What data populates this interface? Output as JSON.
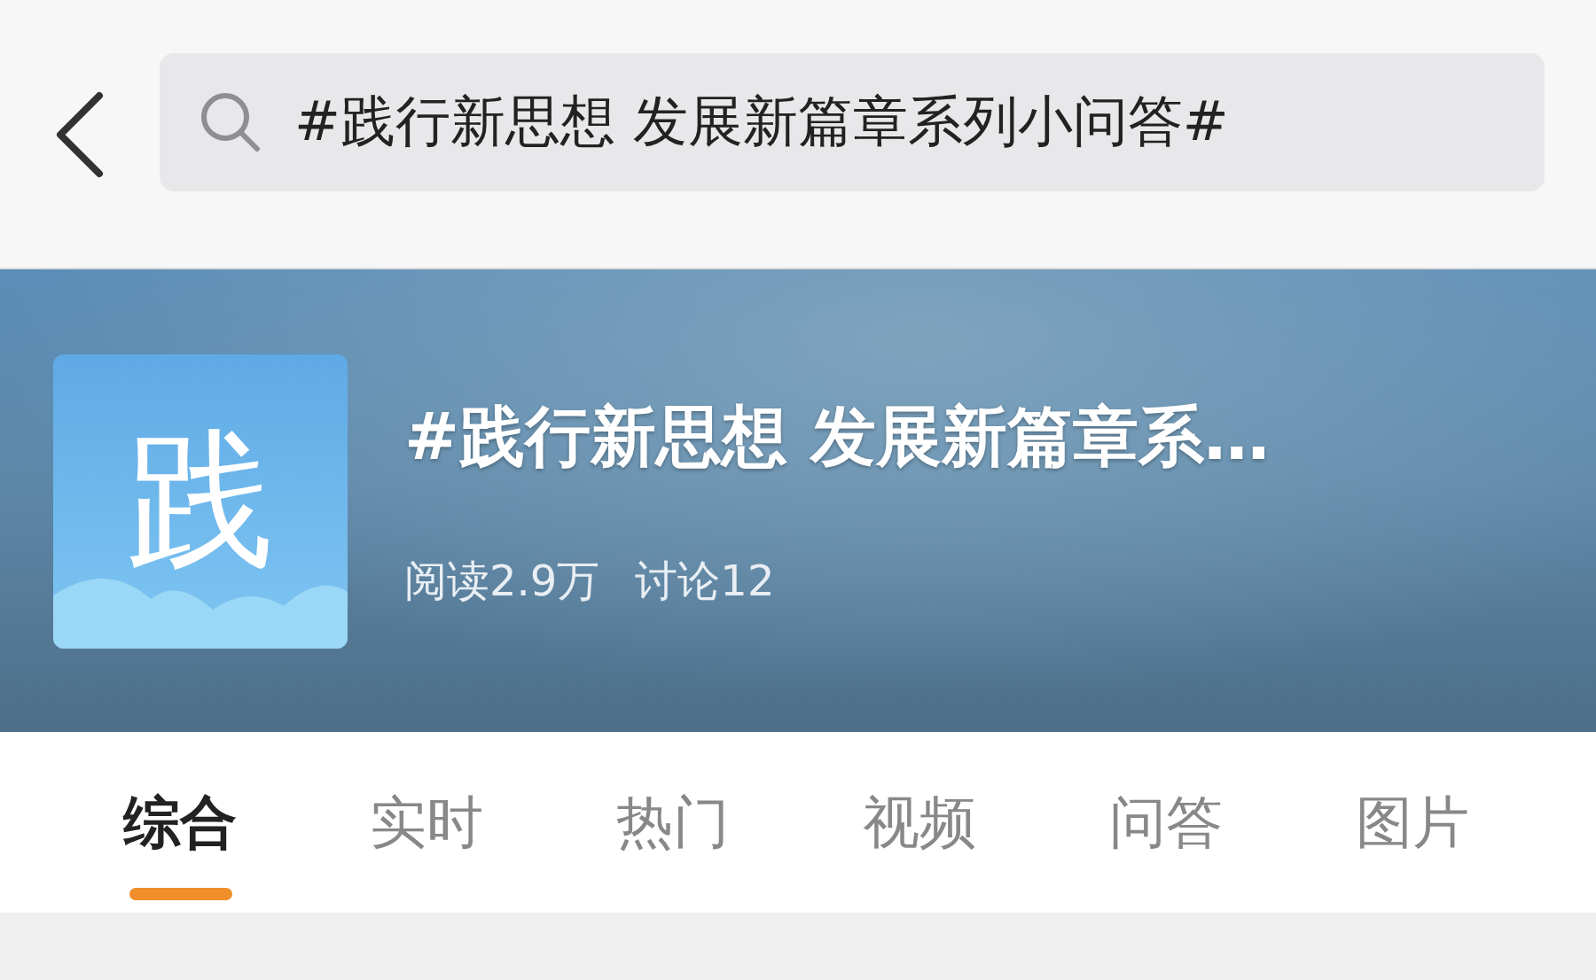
{
  "search": {
    "value": "#践行新思想 发展新篇章系列小问答#"
  },
  "topic": {
    "avatar": "践",
    "title": "#践行新思想 发展新篇章系…",
    "stats": [
      "阅读2.9万",
      "讨论12"
    ]
  },
  "tabs": [
    {
      "label": "综合",
      "selected": true
    },
    {
      "label": "实时",
      "selected": false
    },
    {
      "label": "热门",
      "selected": false
    },
    {
      "label": "视频",
      "selected": false
    },
    {
      "label": "问答",
      "selected": false
    },
    {
      "label": "图片",
      "selected": false
    }
  ]
}
